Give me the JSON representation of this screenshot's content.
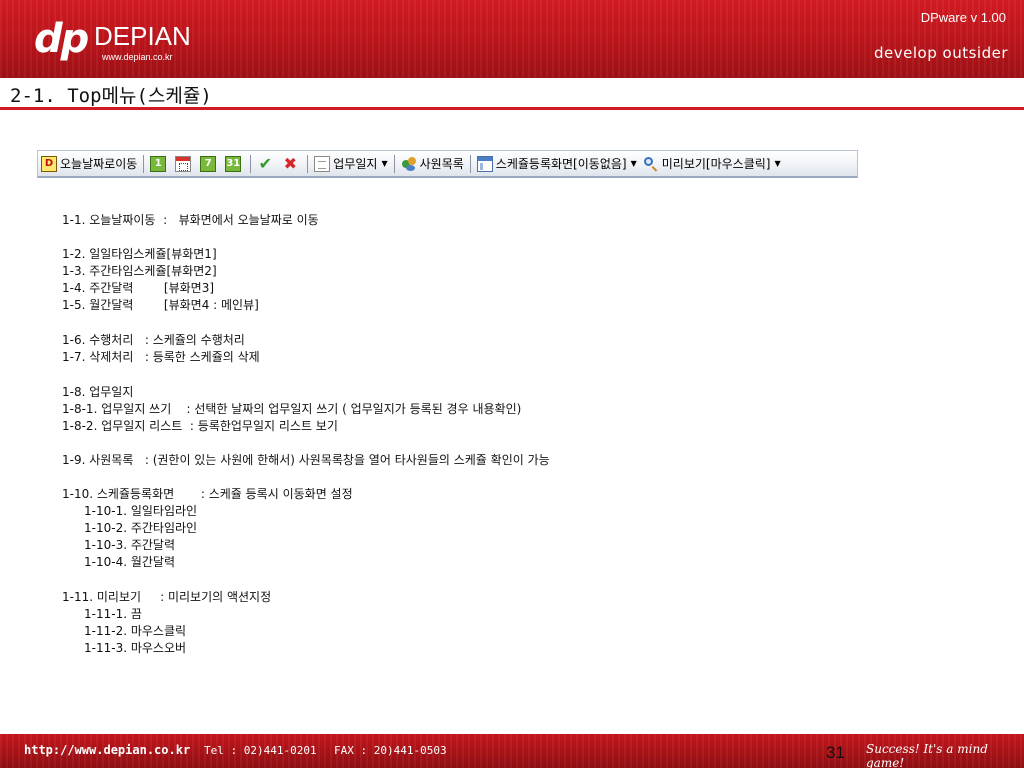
{
  "header": {
    "logo_mark": "dp",
    "brand": "DEPIAN",
    "logo_url": "www.depian.co.kr",
    "version": "DPware v 1.00",
    "slogan": "develop outsider"
  },
  "page_title": "2-1. Top메뉴(스케쥴)",
  "toolbar": {
    "today_label": "오늘날짜로이동",
    "day_icon": "1",
    "week_icon": "7",
    "month_icon": "31",
    "worklog_label": "업무일지",
    "staff_label": "사원목록",
    "schedule_label": "스케쥴등록화면[이동없음]",
    "preview_label": "미리보기[마우스클릭]",
    "icons": [
      "depian-d-icon",
      "day-view-icon",
      "calendar-icon",
      "week-view-icon",
      "month-view-icon",
      "check-icon",
      "delete-icon",
      "document-icon",
      "users-icon",
      "window-icon",
      "magnifier-icon"
    ],
    "colors": {
      "check": "#2f9a2a",
      "delete": "#d8262b",
      "view_icons": "#78b83a"
    }
  },
  "lines": [
    "1-1. 오늘날짜이동  :   뷰화면에서 오늘날짜로 이동",
    "1-2. 일일타임스케쥴[뷰화면1]",
    "1-3. 주간타임스케쥴[뷰화면2]",
    "1-4. 주간달력        [뷰화면3]",
    "1-5. 월간달력        [뷰화면4 : 메인뷰]",
    "1-6. 수행처리   : 스케쥴의 수행처리",
    "1-7. 삭제처리   : 등록한 스케쥴의 삭제",
    "1-8. 업무일지",
    "1-8-1. 업무일지 쓰기    : 선택한 날짜의 업무일지 쓰기 ( 업무일지가 등록된 경우 내용확인)",
    "1-8-2. 업무일지 리스트  : 등록한업무일지 리스트 보기",
    "1-9. 사원목록   : (권한이 있는 사원에 한해서) 사원목록창을 열어 타사원들의 스케쥴 확인이 가능",
    "1-10. 스케쥴등록화면       : 스케쥴 등록시 이동화면 설정",
    "1-10-1. 일일타임라인",
    "1-10-2. 주간타임라인",
    "1-10-3. 주간달력",
    "1-10-4. 월간달력",
    "1-11. 미리보기     : 미리보기의 액션지정",
    "1-11-1. 끔",
    "1-11-2. 마우스클릭",
    "1-11-3. 마우스오버"
  ],
  "footer": {
    "url": "http://www.depian.co.kr",
    "tel": "Tel : 02)441-0201",
    "fax": "FAX : 20)441-0503",
    "page_number": "31",
    "motto": "Success! It's a mind game!"
  },
  "colors": {
    "brand_red": "#c4161d",
    "rule": "#d21a22"
  }
}
